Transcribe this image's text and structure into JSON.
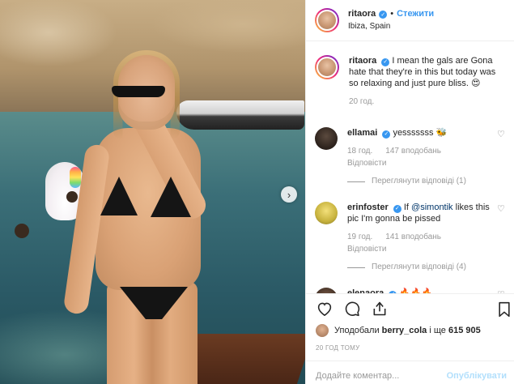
{
  "post": {
    "username": "ritaora",
    "follow_label": "Стежити",
    "separator": "•",
    "location": "Ibiza, Spain"
  },
  "caption": {
    "username": "ritaora",
    "text": "I mean the gals are Gona hate that they're in this but today was so relaxing and just pure bliss.",
    "emoji": "😍",
    "time": "20 год."
  },
  "comments": [
    {
      "username": "ellamai",
      "text": "yesssssss",
      "emoji": "🐝",
      "time": "18 год.",
      "likes": "147 вподобань",
      "reply_label": "Відповісти",
      "view_replies": "Переглянути відповіді (1)"
    },
    {
      "username": "erinfoster",
      "text_pre": "If ",
      "mention": "@simontik",
      "text_post": " likes this pic I'm gonna be pissed",
      "time": "19 год.",
      "likes": "141 вподобань",
      "reply_label": "Відповісти",
      "view_replies": "Переглянути відповіді (4)"
    },
    {
      "username": "elenaora",
      "emoji": "🔥🔥🔥"
    }
  ],
  "likes_line": {
    "prefix": "Уподобали ",
    "user": "berry_cola",
    "middle": " і ще ",
    "count": "615 905"
  },
  "timestamp": "20 ГОД ТОМУ",
  "comment_input": {
    "placeholder": "Додайте коментар..."
  },
  "publish_label": "Опублікувати",
  "colors": {
    "accent": "#3897f0",
    "muted": "#999999",
    "publish_disabled": "#b2dffc"
  },
  "icons": [
    "verified-icon",
    "heart-icon",
    "comment-icon",
    "share-icon",
    "bookmark-icon",
    "next-arrow-icon"
  ]
}
